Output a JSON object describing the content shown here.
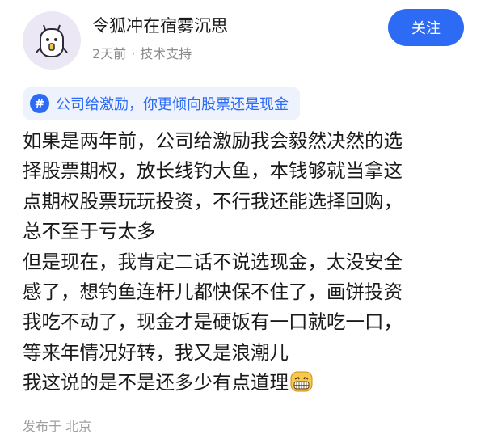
{
  "author": {
    "name": "令狐冲在宿雾沉思",
    "time": "2天前",
    "separator": "·",
    "category": "技术支持"
  },
  "follow_button": {
    "label": "关注"
  },
  "topic": {
    "icon": "#",
    "label": "公司给激励，你更倾向股票还是现金"
  },
  "post": {
    "lines": [
      "如果是两年前，公司给激励我会毅然决然的选",
      "择股票期权，放长线钓大鱼，本钱够就当拿这",
      "点期权股票玩玩投资，不行我还能选择回购，",
      "总不至于亏太多",
      "但是现在，我肯定二话不说选现金，太没安全",
      "感了，想钓鱼连杆儿都快保不住了，画饼投资",
      "我吃不动了，现金才是硬饭有一口就吃一口，",
      "等来年情况好转，我又是浪潮儿",
      "我这说的是不是还多少有点道理"
    ],
    "trailing_emoji": "grinning-face-emoji"
  },
  "location": "发布于 北京",
  "colors": {
    "accent": "#2d6bf5",
    "tag_background": "#edf2fd",
    "avatar_background": "#ebe7f4",
    "meta_text": "#8a8a8a"
  }
}
